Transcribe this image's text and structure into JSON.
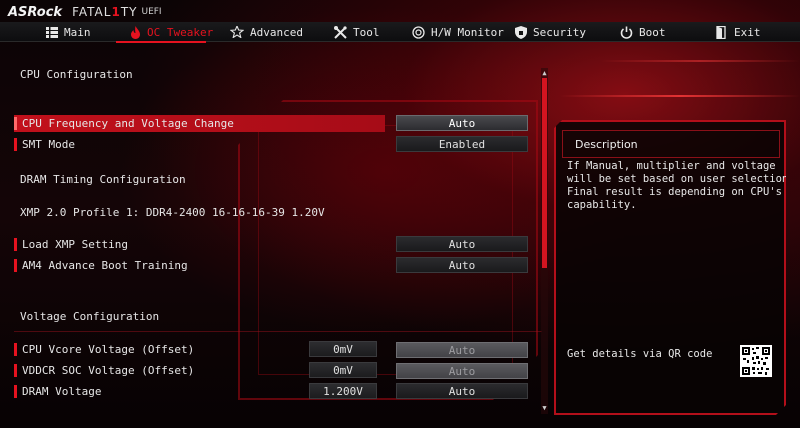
{
  "brand": {
    "vendor": "ASRock",
    "line_prefix": "FATAL",
    "line_mark": "1",
    "line_suffix": "TY",
    "suffix": "UEFI"
  },
  "nav": {
    "items": [
      {
        "label": "Main",
        "icon": "grid-icon"
      },
      {
        "label": "OC Tweaker",
        "icon": "flame-icon"
      },
      {
        "label": "Advanced",
        "icon": "star-icon"
      },
      {
        "label": "Tool",
        "icon": "wrench-screwdriver-icon"
      },
      {
        "label": "H/W Monitor",
        "icon": "gauge-icon"
      },
      {
        "label": "Security",
        "icon": "shield-icon"
      },
      {
        "label": "Boot",
        "icon": "power-icon"
      },
      {
        "label": "Exit",
        "icon": "exit-door-icon"
      }
    ],
    "active": "OC Tweaker"
  },
  "settings": {
    "section_cpu": "CPU Configuration",
    "cpu_freq_label": "CPU Frequency and Voltage Change",
    "cpu_freq_value": "Auto",
    "smt_label": "SMT Mode",
    "smt_value": "Enabled",
    "section_dram": "DRAM Timing Configuration",
    "xmp_info": "XMP 2.0 Profile 1: DDR4-2400 16-16-16-39 1.20V",
    "load_xmp_label": "Load XMP Setting",
    "load_xmp_value": "Auto",
    "am4_label": "AM4 Advance Boot Training",
    "am4_value": "Auto",
    "section_voltage": "Voltage Configuration",
    "vcore_label": "CPU Vcore Voltage (Offset)",
    "vcore_reading": "0mV",
    "vcore_value": "Auto",
    "vddcr_label": "VDDCR SOC Voltage (Offset)",
    "vddcr_reading": "0mV",
    "vddcr_value": "Auto",
    "dram_v_label": "DRAM Voltage",
    "dram_v_reading": "1.200V",
    "dram_v_value": "Auto"
  },
  "description": {
    "title": "Description",
    "lines": [
      "If Manual, multiplier and voltage",
      "will be set based on user selection.",
      "Final result is depending on CPU's",
      "capability."
    ],
    "qr_label": "Get details via QR code"
  },
  "colors": {
    "accent": "#e5121f",
    "selected_row": "#c2101b"
  }
}
